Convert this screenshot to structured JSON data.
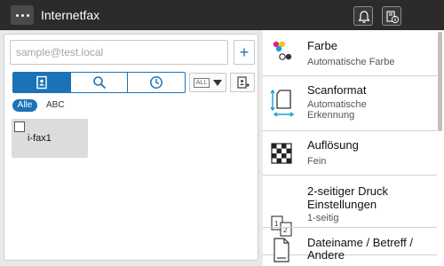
{
  "header": {
    "title": "Internetfax",
    "menu_icon": "more-dots-icon",
    "right_icons": [
      "bell-icon",
      "device-info-icon"
    ]
  },
  "address_panel": {
    "input_placeholder": "sample@test.local",
    "add_button_label": "+",
    "tabs": [
      {
        "name": "addressbook-tab",
        "icon": "address-book-icon",
        "active": true
      },
      {
        "name": "search-tab",
        "icon": "search-icon",
        "active": false
      },
      {
        "name": "history-tab",
        "icon": "clock-icon",
        "active": false
      }
    ],
    "filter_dropdown_label": "ALL",
    "filters": {
      "all": "Alle",
      "abc": "ABC"
    },
    "entries": [
      {
        "label": "i-fax1",
        "checked": false
      }
    ]
  },
  "settings": [
    {
      "title": "Farbe",
      "value": "Automatische  Farbe",
      "icon": "color-dots-icon"
    },
    {
      "title": "Scanformat",
      "value": "Automatische\nErkennung",
      "icon": "scan-size-icon"
    },
    {
      "title": "Auflösung",
      "value": "Fein",
      "icon": "resolution-grid-icon"
    },
    {
      "title": "2-seitiger  Druck\nEinstellungen",
      "value": "1-seitig",
      "icon": "duplex-pages-icon"
    },
    {
      "title": "Dateiname  /  Betreff  /\nAndere",
      "value": "",
      "icon": "document-icon"
    }
  ],
  "colors": {
    "accent": "#1a73b8",
    "topbar": "#2b2b2b"
  }
}
